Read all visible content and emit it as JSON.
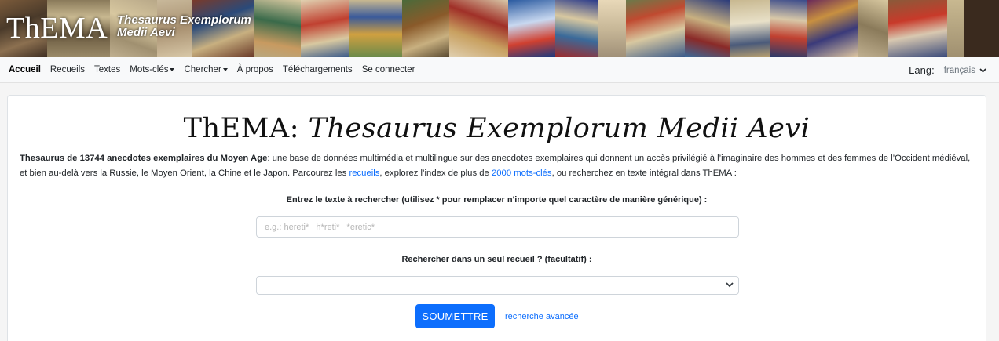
{
  "banner": {
    "logo": "ThEMA",
    "subtitle_line1": "Thesaurus Exemplorum",
    "subtitle_line2": "Medii Aevi"
  },
  "nav": {
    "items": [
      {
        "label": "Accueil",
        "active": true
      },
      {
        "label": "Recueils"
      },
      {
        "label": "Textes"
      },
      {
        "label": "Mots-clés",
        "dropdown": true
      },
      {
        "label": "Chercher",
        "dropdown": true
      },
      {
        "label": "À propos"
      },
      {
        "label": "Téléchargements"
      },
      {
        "label": "Se connecter"
      }
    ],
    "lang_label": "Lang:",
    "lang_value": "français"
  },
  "main": {
    "title_plain": "ThEMA: ",
    "title_italic": "Thesaurus Exemplorum Medii Aevi",
    "intro_bold": "Thesaurus de 13744 anecdotes exemplaires du Moyen Age",
    "intro_text1": ": une base de données multimédia et multilingue sur des anecdotes exemplaires qui donnent un accès privilégié à l’imaginaire des hommes et des femmes de l’Occident médiéval, et bien au-delà vers la Russie, le Moyen Orient, la Chine et le Japon. Parcourez les ",
    "intro_link1": "recueils",
    "intro_text2": ", explorez l’index de plus de ",
    "intro_link2": "2000 mots-clés",
    "intro_text3": ", ou recherchez en texte intégral dans ThEMA :",
    "search_label": "Entrez le texte à rechercher (utilisez * pour remplacer n'importe quel caractère de manière générique) :",
    "search_placeholder": "e.g.: hereti*   h*reti*   *eretic*",
    "search_value": "",
    "collection_label": "Rechercher dans un seul recueil ? (facultatif) :",
    "collection_value": "",
    "submit_label": "SOUMETTRE",
    "advanced_link": "recherche avancée"
  },
  "colors": {
    "accent": "#0d6efd",
    "nav_bg": "#f8f9fa",
    "page_bg": "#f5f5f5"
  }
}
